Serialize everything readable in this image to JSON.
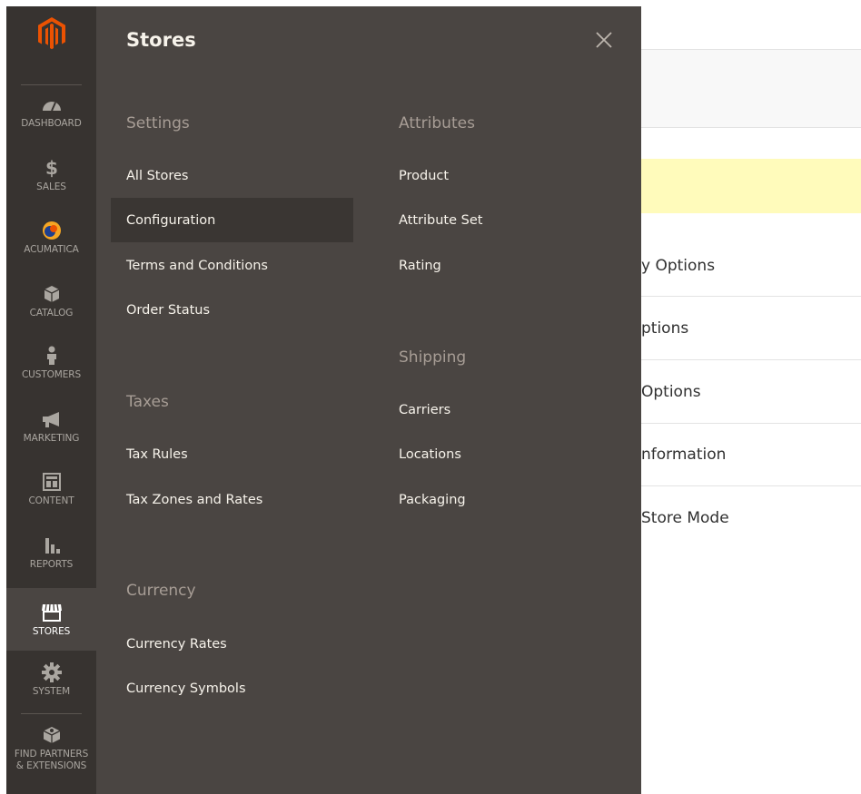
{
  "colors": {
    "sidebar_bg": "#373330",
    "flyout_bg": "#4a4542",
    "active_item_bg": "#3a3633",
    "brand_orange": "#eb5202",
    "section_heading": "#a79d95",
    "notice_yellow": "#fffbbb"
  },
  "sidebar": {
    "logo_icon": "magento-logo-icon",
    "items": [
      {
        "label": "DASHBOARD",
        "icon": "speedometer-icon"
      },
      {
        "label": "SALES",
        "icon": "dollar-icon"
      },
      {
        "label": "ACUMATICA",
        "icon": "acumatica-icon"
      },
      {
        "label": "CATALOG",
        "icon": "box-icon"
      },
      {
        "label": "CUSTOMERS",
        "icon": "person-icon"
      },
      {
        "label": "MARKETING",
        "icon": "megaphone-icon"
      },
      {
        "label": "CONTENT",
        "icon": "layout-icon"
      },
      {
        "label": "REPORTS",
        "icon": "bar-chart-icon"
      },
      {
        "label": "STORES",
        "icon": "store-icon",
        "active": true
      },
      {
        "label": "SYSTEM",
        "icon": "gear-icon"
      },
      {
        "label": "FIND PARTNERS\n& EXTENSIONS",
        "icon": "extensions-box-icon"
      }
    ]
  },
  "flyout": {
    "title": "Stores",
    "close_icon": "close-icon",
    "columns": {
      "settings": {
        "heading": "Settings",
        "items": [
          "All Stores",
          "Configuration",
          "Terms and Conditions",
          "Order Status"
        ]
      },
      "taxes": {
        "heading": "Taxes",
        "items": [
          "Tax Rules",
          "Tax Zones and Rates"
        ]
      },
      "currency": {
        "heading": "Currency",
        "items": [
          "Currency Rates",
          "Currency Symbols"
        ]
      },
      "attributes": {
        "heading": "Attributes",
        "items": [
          "Product",
          "Attribute Set",
          "Rating"
        ]
      },
      "shipping": {
        "heading": "Shipping",
        "items": [
          "Carriers",
          "Locations",
          "Packaging"
        ]
      }
    },
    "selected_item": "Configuration"
  },
  "background_page": {
    "rows": [
      "y Options",
      "ptions",
      "Options",
      "nformation",
      "Store Mode"
    ]
  }
}
